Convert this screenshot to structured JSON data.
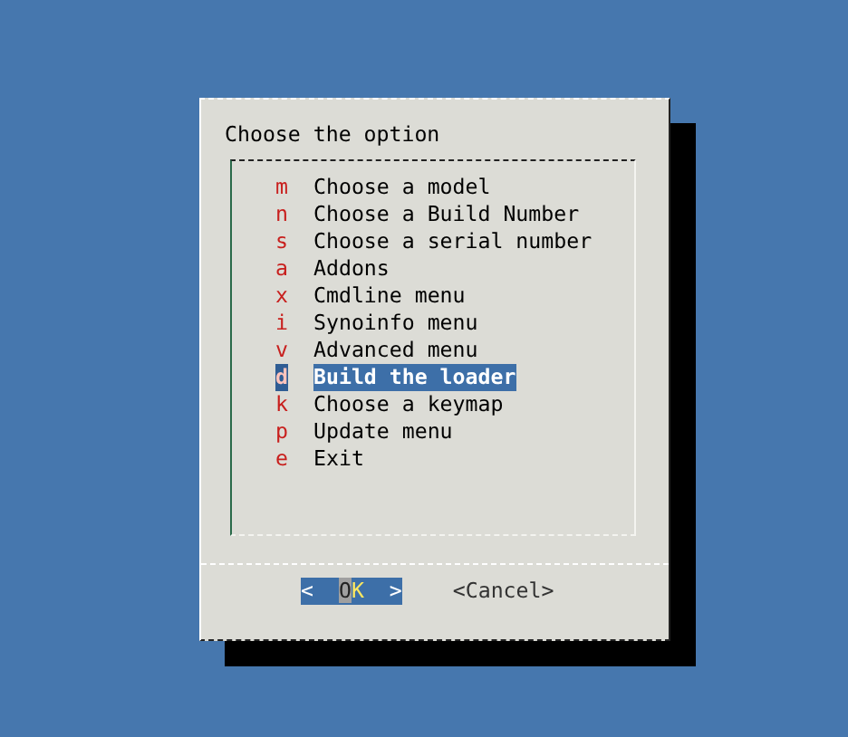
{
  "dialog": {
    "prompt": "Choose the option",
    "items": [
      {
        "key": "m",
        "label": "Choose a model",
        "selected": false
      },
      {
        "key": "n",
        "label": "Choose a Build Number",
        "selected": false
      },
      {
        "key": "s",
        "label": "Choose a serial number",
        "selected": false
      },
      {
        "key": "a",
        "label": "Addons",
        "selected": false
      },
      {
        "key": "x",
        "label": "Cmdline menu",
        "selected": false
      },
      {
        "key": "i",
        "label": "Synoinfo menu",
        "selected": false
      },
      {
        "key": "v",
        "label": "Advanced menu",
        "selected": false
      },
      {
        "key": "d",
        "label": "Build the loader",
        "selected": true
      },
      {
        "key": "k",
        "label": "Choose a keymap",
        "selected": false
      },
      {
        "key": "p",
        "label": "Update menu",
        "selected": false
      },
      {
        "key": "e",
        "label": "Exit",
        "selected": false
      }
    ],
    "buttons": [
      {
        "open": "<",
        "label": "OK",
        "close": ">",
        "selected": true
      },
      {
        "open": "<",
        "label": "Cancel",
        "close": ">",
        "selected": false
      }
    ]
  }
}
